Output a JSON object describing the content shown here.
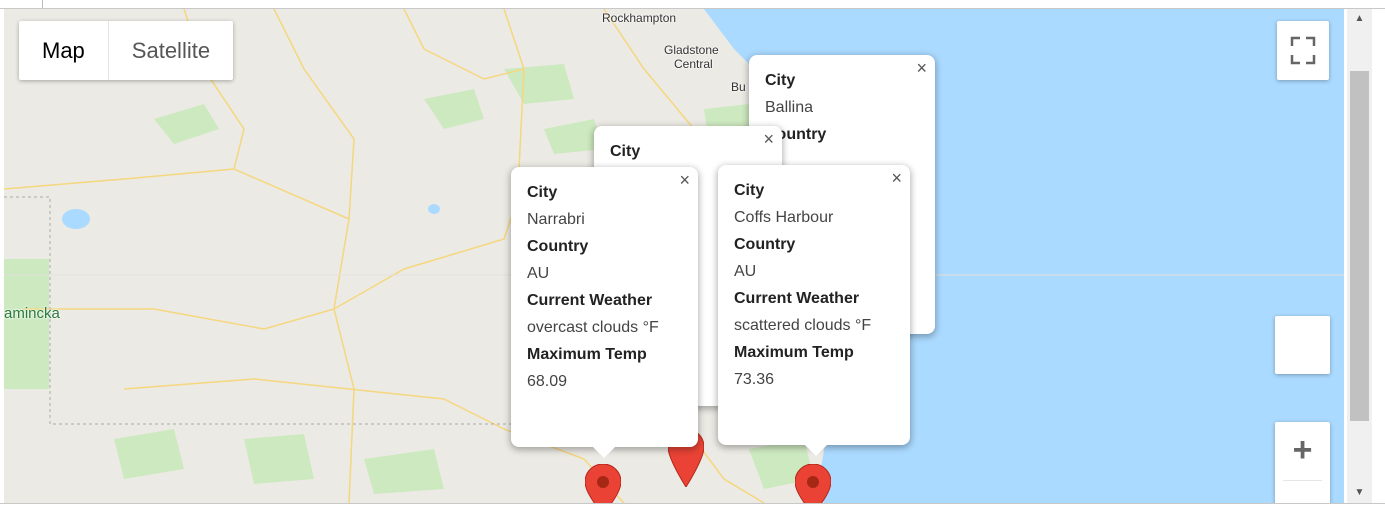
{
  "map_type": {
    "map_label": "Map",
    "satellite_label": "Satellite",
    "selected": "Map"
  },
  "map_labels": {
    "rockhampton": "Rockhampton",
    "gladstone": "Gladstone",
    "gladstone_central": "Central",
    "bu": "Bu",
    "innamincka": "amincka"
  },
  "controls": {
    "zoom_in_label": "+",
    "fullscreen_icon": "fullscreen-icon"
  },
  "scrollbar": {
    "up_arrow": "▲",
    "down_arrow": "▼"
  },
  "colors": {
    "sea": "#aadaff",
    "land": "#eceae4",
    "park": "#cde9c0",
    "marker": "#ea4335"
  },
  "popups": {
    "ballina": {
      "city_label": "City",
      "city": "Ballina",
      "country_label": "Country"
    },
    "back": {
      "city_label": "City"
    },
    "narrabri": {
      "city_label": "City",
      "city": "Narrabri",
      "country_label": "Country",
      "country": "AU",
      "weather_label": "Current Weather",
      "weather": "overcast clouds °F",
      "temp_label": "Maximum Temp",
      "temp": "68.09"
    },
    "coffs": {
      "city_label": "City",
      "city": "Coffs Harbour",
      "country_label": "Country",
      "country": "AU",
      "weather_label": "Current Weather",
      "weather": "scattered clouds °F",
      "temp_label": "Maximum Temp",
      "temp": "73.36"
    }
  },
  "close_glyph": "×"
}
